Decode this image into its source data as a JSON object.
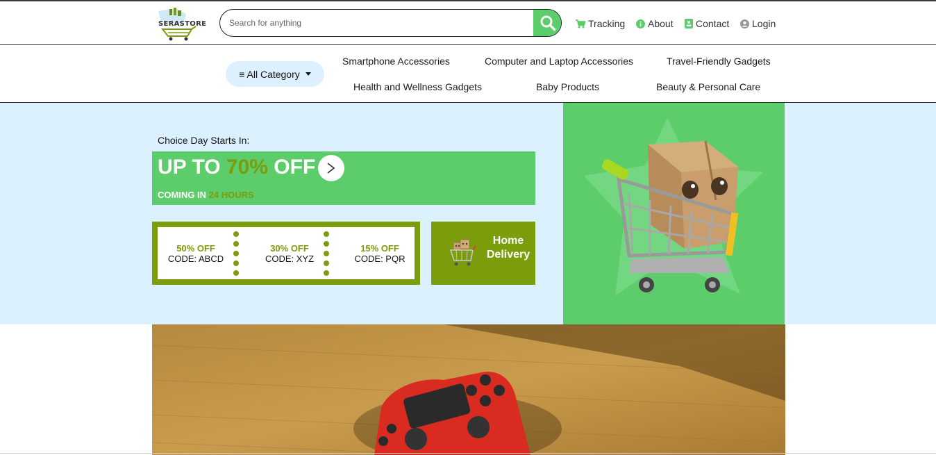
{
  "header": {
    "logo_text": "SERASTORE",
    "search": {
      "placeholder": "Search for anything",
      "value": ""
    },
    "nav": [
      {
        "label": "Tracking",
        "icon": "cart-icon"
      },
      {
        "label": "About",
        "icon": "info-icon"
      },
      {
        "label": "Contact",
        "icon": "contact-card-icon"
      },
      {
        "label": "Login",
        "icon": "user-icon"
      }
    ]
  },
  "category_bar": {
    "all_category_label": "≡ All Category",
    "categories": [
      "Smartphone Accessories",
      "Computer and Laptop Accessories",
      "Travel-Friendly Gadgets",
      "Health and Wellness Gadgets",
      "Baby Products",
      "Beauty & Personal Care"
    ]
  },
  "hero": {
    "choice_text": "Choice Day Starts In:",
    "promo": {
      "prefix": "UP TO ",
      "percent": "70%",
      "suffix": " OFF",
      "arrow": ">",
      "sub_prefix": "COMING IN ",
      "sub_highlight": "24 HOURS"
    },
    "coupons": [
      {
        "off": "50% OFF",
        "code": "CODE: ABCD"
      },
      {
        "off": "30% OFF",
        "code": "CODE: XYZ"
      },
      {
        "off": "15% OFF",
        "code": "CODE: PQR"
      }
    ],
    "delivery_label": "Home Delivery"
  },
  "colors": {
    "brand_green": "#5ccd6a",
    "olive": "#7b9c0b",
    "light_blue": "#dbf1fd"
  }
}
